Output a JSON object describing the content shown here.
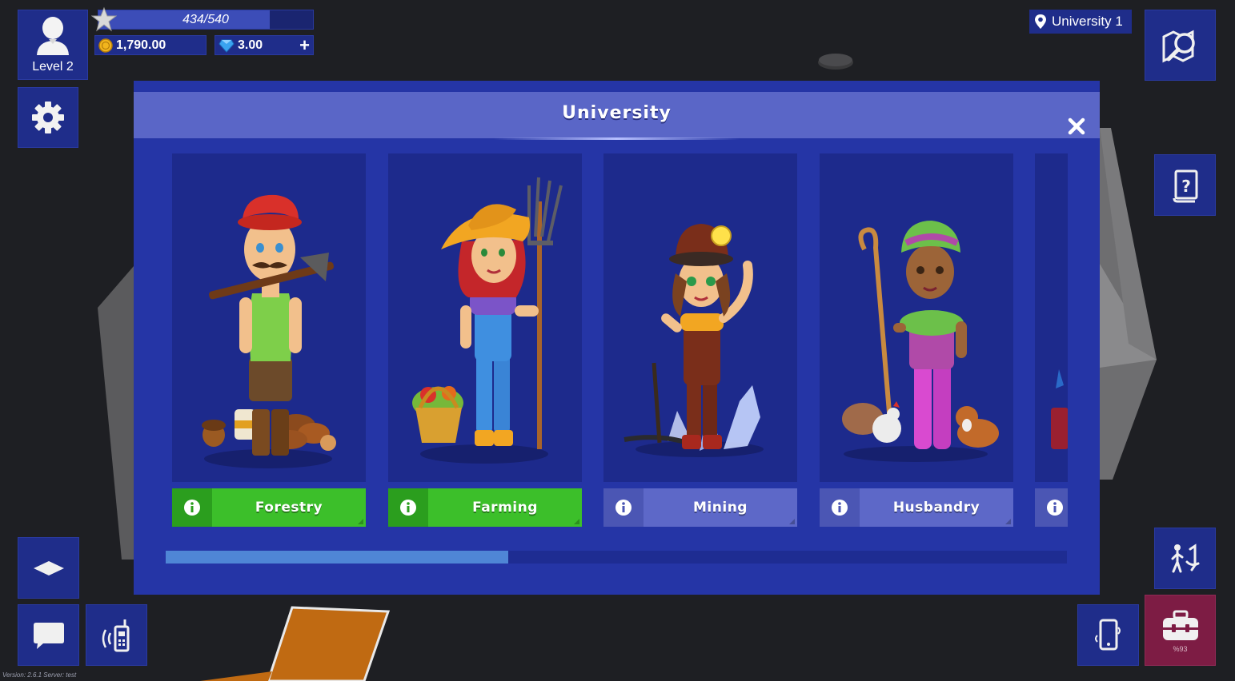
{
  "player": {
    "level_label": "Level 2",
    "xp_text": "434/540",
    "xp_progress": 0.8,
    "coins": "1,790.00",
    "gems": "3.00",
    "add_gems_label": "+"
  },
  "location": {
    "name": "University 1"
  },
  "inventory": {
    "capacity_text": "%93"
  },
  "modal": {
    "title": "University",
    "close_label": "✕",
    "courses": [
      {
        "label": "Forestry",
        "state": "unlocked",
        "color": "#3cbf2a"
      },
      {
        "label": "Farming",
        "state": "unlocked",
        "color": "#3cbf2a"
      },
      {
        "label": "Mining",
        "state": "locked",
        "color": "#5d68c8"
      },
      {
        "label": "Husbandry",
        "state": "locked",
        "color": "#5d68c8"
      },
      {
        "label": "",
        "state": "locked",
        "color": "#5d68c8"
      }
    ],
    "scroll_progress": 0.38
  },
  "footer": {
    "version_text": "Version: 2.6.1 Server: test"
  },
  "colors": {
    "hud_blue": "#1f2d8a",
    "modal_bg": "#2535a6",
    "header_bg": "#5a66c7",
    "inventory_red": "#7d1c44",
    "scroll_thumb": "#4f86d6"
  },
  "icons": [
    "person-icon",
    "gear-icon",
    "star-icon",
    "coin-icon",
    "gem-icon",
    "location-pin-icon",
    "map-search-icon",
    "quest-book-icon",
    "hire-workers-icon",
    "phone-icon",
    "toolbox-icon",
    "layers-icon",
    "chat-icon",
    "radio-icon",
    "close-icon",
    "info-icon"
  ]
}
